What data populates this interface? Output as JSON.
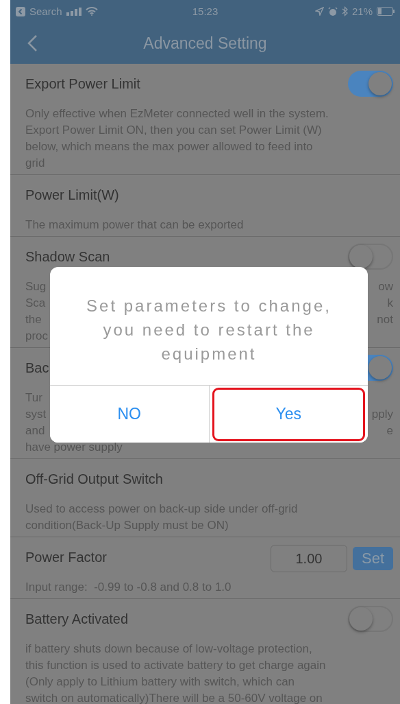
{
  "status_bar": {
    "back_label": "Search",
    "time": "15:23",
    "battery": "21%"
  },
  "nav": {
    "title": "Advanced Setting"
  },
  "sections": [
    {
      "title": "Export Power Limit",
      "control": {
        "kind": "toggle",
        "on": true
      },
      "lines": [
        "Only effective when EzMeter connected well in the system.",
        "Export Power Limit ON, then you can set Power Limit (W)",
        "below, which means the max power allowed to feed into",
        "grid"
      ]
    },
    {
      "title": "Power Limit(W)",
      "lines": [
        "The maximum power that can be exported"
      ]
    },
    {
      "title": "Shadow Scan",
      "control": {
        "kind": "toggle",
        "on": false
      },
      "lines": [
        {
          "left": "Sug",
          "right": "ow"
        },
        {
          "left": "Sca",
          "right": "k"
        },
        {
          "left": "the",
          "right": "not"
        },
        {
          "left": "proc"
        }
      ]
    },
    {
      "title": "Bac",
      "control": {
        "kind": "toggle",
        "on": true
      },
      "lines": [
        {
          "left": "Tur"
        },
        {
          "left": "syst",
          "right": "pply"
        },
        {
          "left": "and",
          "right": "e"
        },
        "have power supply"
      ]
    },
    {
      "title": "Off-Grid Output Switch",
      "lines": [
        "Used to access power on back-up side under off-grid",
        "condition(Back-Up Supply must be ON)"
      ]
    },
    {
      "title": "Power Factor",
      "control": {
        "kind": "input",
        "value": "1.00",
        "button": "Set"
      },
      "lines": [
        "Input range:  -0.99 to -0.8 and 0.8 to 1.0"
      ]
    },
    {
      "title": "Battery Activated",
      "control": {
        "kind": "toggle",
        "on": false
      },
      "lines": [
        "if battery shuts down because of low-voltage protection,",
        "this function is used to activate battery to get charge again",
        "(Only apply to Lithium battery with switch, which can",
        "switch on automatically)There will be a 50-60V voltage on"
      ]
    }
  ],
  "dialog": {
    "message": "Set parameters to change, you need to restart the equipment",
    "buttons": [
      {
        "label": "NO",
        "highlighted": false
      },
      {
        "label": "Yes",
        "highlighted": true
      }
    ]
  }
}
